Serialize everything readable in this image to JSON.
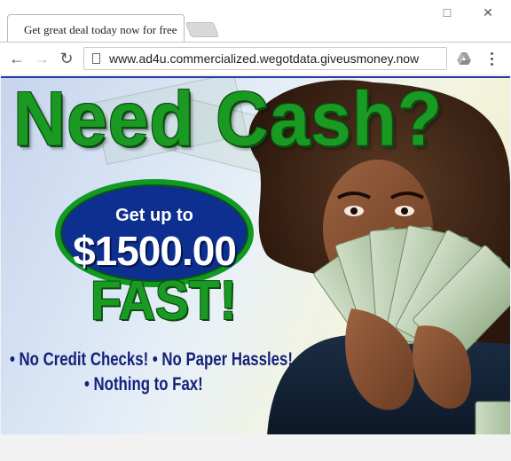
{
  "browser": {
    "tab_title": "Get great deal today now for free",
    "url": "www.ad4u.commercialized.wegotdata.giveusmoney.now",
    "window_controls": {
      "maximize_icon": "□",
      "close_icon": "✕"
    },
    "nav": {
      "back_icon": "←",
      "forward_icon": "→",
      "reload_icon": "↻"
    }
  },
  "ad": {
    "headline": "Need Cash?",
    "offer_line1": "Get up to",
    "offer_amount": "$1500.00",
    "offer_speed": "FAST!",
    "bullets": [
      "• No Credit Checks! • No Paper Hassles!",
      "• Nothing to Fax!"
    ]
  },
  "colors": {
    "headline_green": "#1a9a23",
    "oval_blue": "#0d2f8f",
    "bullet_navy": "#14237a"
  }
}
